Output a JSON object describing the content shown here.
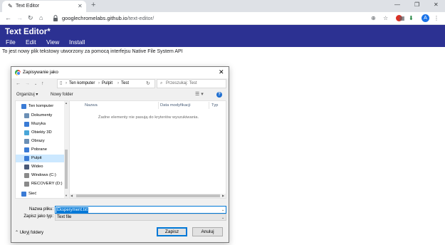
{
  "browser": {
    "tab_title": "Text Editor",
    "tab_icon": "✎",
    "new_tab_label": "+",
    "url_host": "googlechromelabs.github.io",
    "url_path": "/text-editor/"
  },
  "app": {
    "title": "Text Editor*",
    "menu": [
      "File",
      "Edit",
      "View",
      "Install"
    ],
    "intro_text": "To jest nowy plik tekstowy utworzony za pomocą interfejsu Native File System API"
  },
  "dialog": {
    "title": "Zapisywanie jako",
    "breadcrumb": [
      "Ten komputer",
      "Pulpit",
      "Test"
    ],
    "search_placeholder": "Przeszukaj: Test",
    "organize_label": "Organizuj ▾",
    "new_folder_label": "Nowy folder",
    "nav_items": [
      {
        "label": "Ten komputer",
        "icon": "computer-icon",
        "color": "#3a7bd5"
      },
      {
        "label": "Dokumenty",
        "icon": "documents-icon",
        "color": "#6b8fb5"
      },
      {
        "label": "Muzyka",
        "icon": "music-icon",
        "color": "#3a7bd5"
      },
      {
        "label": "Obiekty 3D",
        "icon": "objects-3d-icon",
        "color": "#49a6d8"
      },
      {
        "label": "Obrazy",
        "icon": "pictures-icon",
        "color": "#6b8fb5"
      },
      {
        "label": "Pobrane",
        "icon": "downloads-icon",
        "color": "#3a7bd5"
      },
      {
        "label": "Pulpit",
        "icon": "desktop-icon",
        "color": "#3a7bd5"
      },
      {
        "label": "Wideo",
        "icon": "video-icon",
        "color": "#4a5a78"
      },
      {
        "label": "Windows (C:)",
        "icon": "drive-icon",
        "color": "#8a8a8a"
      },
      {
        "label": "RECOVERY (D:)",
        "icon": "drive-icon",
        "color": "#8a8a8a"
      },
      {
        "label": "Sieć",
        "icon": "network-icon",
        "color": "#3a7bd5"
      }
    ],
    "selected_nav": "Pulpit",
    "columns": [
      "Nazwa",
      "Data modyfikacji",
      "Typ"
    ],
    "empty_message": "Żadne elementy nie pasują do kryteriów wyszukiwania.",
    "filename_label": "Nazwa pliku:",
    "filename_value": "Eksperyment.txt",
    "filetype_label": "Zapisz jako typ:",
    "filetype_value": "Text file",
    "hide_folders_label": "Ukryj foldery",
    "save_label": "Zapisz",
    "cancel_label": "Anuluj"
  },
  "colors": {
    "app_bar": "#2c3192",
    "selection": "#0078d7",
    "nav_selected": "#cce8ff"
  }
}
